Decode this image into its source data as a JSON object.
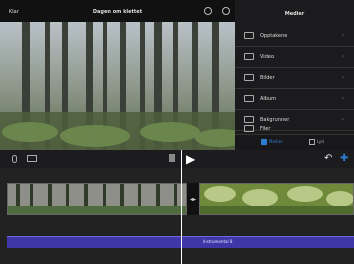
{
  "topbar": {
    "left_label": "Klar",
    "title": "Dagen om klettet",
    "help_icon": "help-icon",
    "settings_icon": "settings-icon"
  },
  "sidebar": {
    "title": "Medier",
    "items": [
      {
        "label": "Opptakene",
        "icon": "clip-icon"
      },
      {
        "label": "Video",
        "icon": "video-icon"
      },
      {
        "label": "Bilder",
        "icon": "photos-icon"
      },
      {
        "label": "Album",
        "icon": "album-icon"
      },
      {
        "label": "Bakgrunner",
        "icon": "backgrounds-icon"
      },
      {
        "label": "Filer",
        "icon": "files-icon"
      }
    ],
    "tabs": [
      {
        "label": "Medier",
        "active": true
      },
      {
        "label": "Lyd",
        "active": false
      }
    ]
  },
  "toolbar": {
    "undo_icon": "undo-icon",
    "settings_icon": "settings-icon",
    "play_icon": "play-icon",
    "audio_icon": "microphone-icon",
    "camera_icon": "camera-icon",
    "add_icon": "add-icon"
  },
  "timeline": {
    "audio_label": "Instrumental 8"
  },
  "colors": {
    "accent": "#2f7dd1",
    "audio": "#3f37a8"
  }
}
